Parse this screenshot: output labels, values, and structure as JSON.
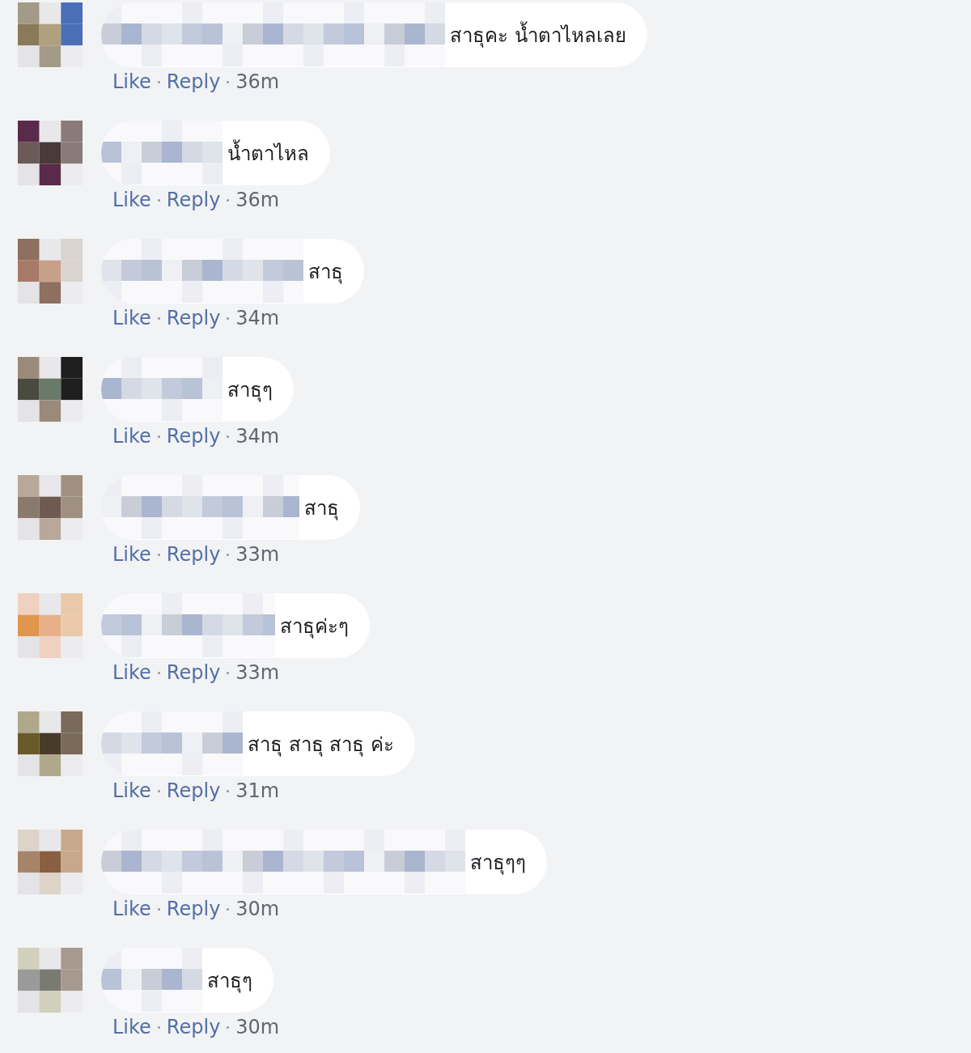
{
  "comments": [
    {
      "text": "สาธุคะ น้ำตาไหลเลย",
      "actions": [
        "Like",
        "Reply"
      ],
      "time": "36m"
    },
    {
      "text": "น้ำตาไหล",
      "actions": [
        "Like",
        "Reply"
      ],
      "time": "36m"
    },
    {
      "text": "สาธุ",
      "actions": [
        "Like",
        "Reply"
      ],
      "time": "34m"
    },
    {
      "text": "สาธุๆ",
      "actions": [
        "Like",
        "Reply"
      ],
      "time": "34m"
    },
    {
      "text": "สาธุ",
      "actions": [
        "Like",
        "Reply"
      ],
      "time": "33m"
    },
    {
      "text": "สาธุค่ะๆ",
      "actions": [
        "Like",
        "Reply"
      ],
      "time": "33m"
    },
    {
      "text": "สาธุ สาธุ สาธุ ค่ะ",
      "actions": [
        "Like",
        "Reply"
      ],
      "time": "31m"
    },
    {
      "text": "สาธุๆๆ",
      "actions": [
        "Like",
        "Reply"
      ],
      "time": "30m"
    },
    {
      "text": "สาธุๆ",
      "actions": [
        "Like",
        "Reply"
      ],
      "time": "30m"
    }
  ]
}
